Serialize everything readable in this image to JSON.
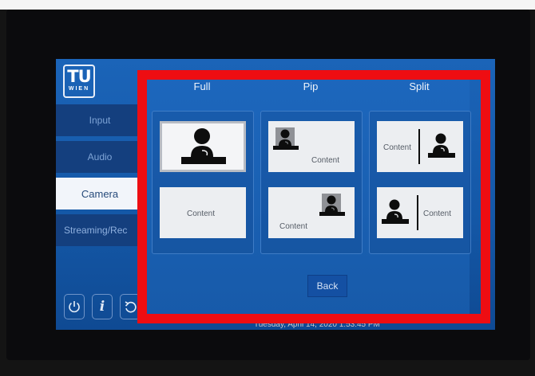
{
  "sidebar": {
    "logo_top": "TU",
    "logo_bottom": "WIEN",
    "items": [
      {
        "label": "Input"
      },
      {
        "label": "Audio"
      },
      {
        "label": "Camera"
      },
      {
        "label": "Streaming/Rec"
      }
    ],
    "active_item": "Camera"
  },
  "layouts": {
    "columns": [
      {
        "title": "Full",
        "tiles": [
          {
            "label": ""
          },
          {
            "label": "Content"
          }
        ]
      },
      {
        "title": "Pip",
        "tiles": [
          {
            "label": "Content"
          },
          {
            "label": "Content"
          }
        ]
      },
      {
        "title": "Split",
        "tiles": [
          {
            "label": "Content"
          },
          {
            "label": "Content"
          }
        ]
      }
    ],
    "selected": "Full - presenter",
    "back_label": "Back"
  },
  "status_bar": {
    "datetime": "Tuesday, April 14, 2020 1:53:45 PM"
  },
  "colors": {
    "screen_blue": "#1b64b8",
    "highlight_frame": "#ee0d12"
  }
}
